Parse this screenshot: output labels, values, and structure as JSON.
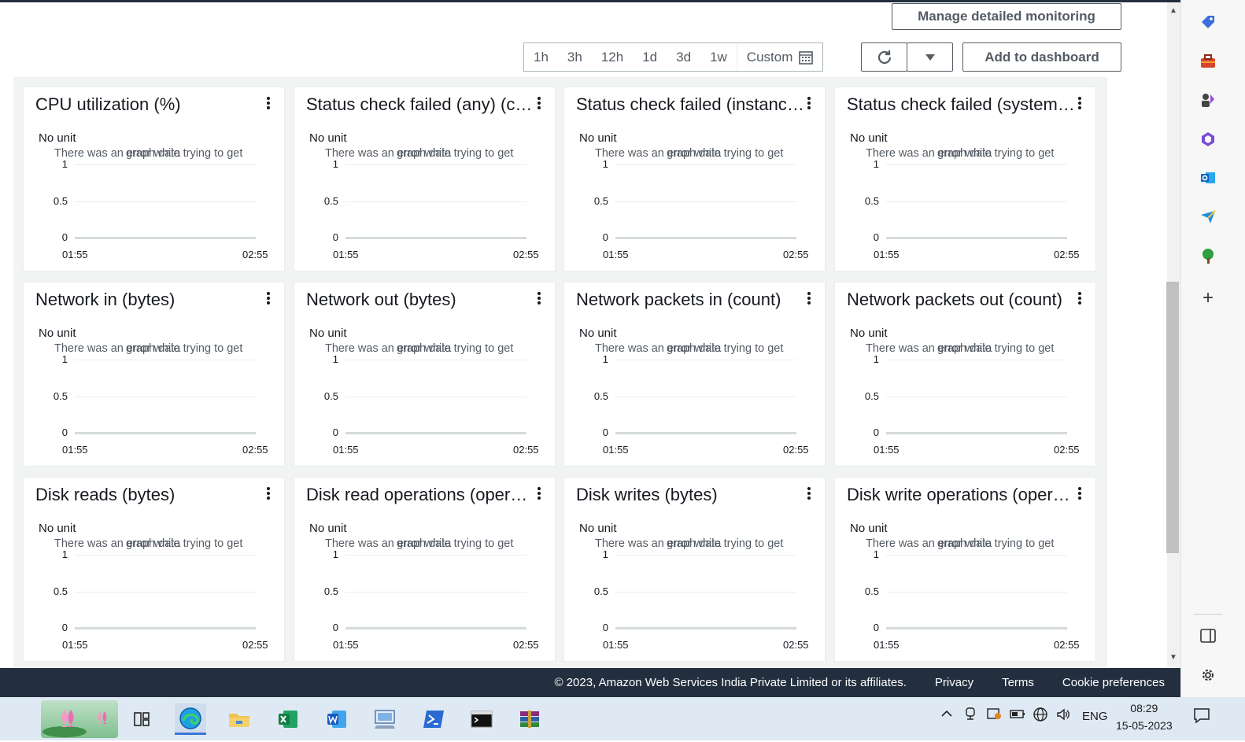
{
  "header": {
    "manage_button": "Manage detailed monitoring",
    "add_dashboard_button": "Add to dashboard",
    "time_ranges": [
      "1h",
      "3h",
      "12h",
      "1d",
      "3d",
      "1w"
    ],
    "custom_label": "Custom"
  },
  "cards": [
    {
      "title": "CPU utilization (%)"
    },
    {
      "title": "Status check failed (any) (count)"
    },
    {
      "title": "Status check failed (instance) (count)"
    },
    {
      "title": "Status check failed (system) (count)"
    },
    {
      "title": "Network in (bytes)"
    },
    {
      "title": "Network out (bytes)"
    },
    {
      "title": "Network packets in (count)"
    },
    {
      "title": "Network packets out (count)"
    },
    {
      "title": "Disk reads (bytes)"
    },
    {
      "title": "Disk read operations (operations)"
    },
    {
      "title": "Disk writes (bytes)"
    },
    {
      "title": "Disk write operations (operations)"
    }
  ],
  "chart_common": {
    "unit_label": "No unit",
    "error_text_a": "There was an error while trying to get",
    "error_text_b": "graph data",
    "y_ticks": [
      "1",
      "0.5",
      "0"
    ],
    "x_ticks": [
      "01:55",
      "02:55"
    ]
  },
  "chart_data": {
    "type": "line",
    "x": [
      "01:55",
      "02:55"
    ],
    "series": [],
    "ylim": [
      0,
      1
    ],
    "ylabel": "No unit"
  },
  "footer": {
    "copyright": "© 2023, Amazon Web Services India Private Limited or its affiliates.",
    "privacy": "Privacy",
    "terms": "Terms",
    "cookie": "Cookie preferences"
  },
  "taskbar": {
    "lang": "ENG",
    "time": "08:29",
    "date": "15-05-2023"
  }
}
